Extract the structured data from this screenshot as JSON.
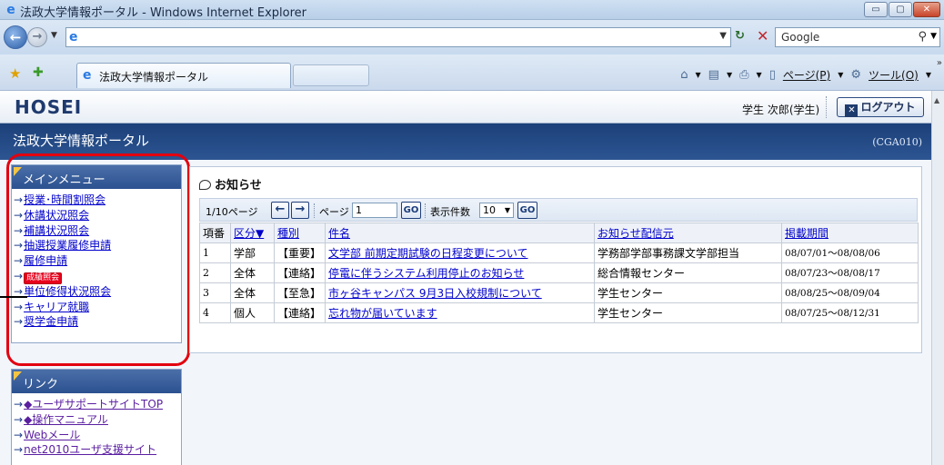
{
  "window": {
    "title": "法政大学情報ポータル - Windows Internet Explorer",
    "buttons": [
      "▭",
      "▢",
      "✕"
    ]
  },
  "address_bar": {
    "url": "",
    "search_placeholder": "Google"
  },
  "tabs": [
    {
      "label": "法政大学情報ポータル"
    }
  ],
  "command_bar": {
    "page_label": "ページ(P)",
    "tools_label": "ツール(O)"
  },
  "header": {
    "logo": "HOSEI",
    "user_name": "学生 次郎(学生)",
    "logout_label": "ログアウト",
    "portal_title": "法政大学情報ポータル",
    "screen_id": "(CGA010)"
  },
  "main_menu": {
    "title": "メインメニュー",
    "items": [
      {
        "label": "授業･時間割照会"
      },
      {
        "label": "休講状況照会"
      },
      {
        "label": "補講状況照会"
      },
      {
        "label": "抽選授業履修申請"
      },
      {
        "label": "履修申請"
      },
      {
        "label": "成績照会"
      },
      {
        "label": "単位修得状況照会"
      },
      {
        "label": "キャリア就職"
      },
      {
        "label": "奨学金申請"
      }
    ]
  },
  "links_menu": {
    "title": "リンク",
    "items": [
      {
        "label": "◆ユーザサポートサイトTOP"
      },
      {
        "label": "◆操作マニュアル"
      },
      {
        "label": "Webメール"
      },
      {
        "label": "net2010ユーザ支援サイト"
      }
    ]
  },
  "notices": {
    "title": "お知らせ",
    "pager": {
      "page_info": "1/10ページ",
      "page_label": "ページ",
      "page_value": "1",
      "per_page_label": "表示件数",
      "per_page_value": "10",
      "go_label": "GO"
    },
    "columns": [
      "項番",
      "区分▼",
      "種別",
      "件名",
      "お知らせ配信元",
      "掲載期間"
    ],
    "rows": [
      {
        "no": "1",
        "category": "学部",
        "type": "【重要】",
        "subject": "文学部 前期定期試験の日程変更について",
        "sender": "学務部学部事務課文学部担当",
        "period": "08/07/01～08/08/06"
      },
      {
        "no": "2",
        "category": "全体",
        "type": "【連絡】",
        "subject": "停電に伴うシステム利用停止のお知らせ",
        "sender": "総合情報センター",
        "period": "08/07/23～08/08/17"
      },
      {
        "no": "3",
        "category": "全体",
        "type": "【至急】",
        "subject": "市ヶ谷キャンパス 9月3日入校規制について",
        "sender": "学生センター",
        "period": "08/08/25～08/09/04"
      },
      {
        "no": "4",
        "category": "個人",
        "type": "【連絡】",
        "subject": "忘れ物が届いています",
        "sender": "学生センター",
        "period": "08/07/25～08/12/31"
      }
    ]
  },
  "colors": {
    "header_blue": "#1d4079",
    "highlight_red": "#e3000f",
    "link_blue": "#0000cc"
  }
}
